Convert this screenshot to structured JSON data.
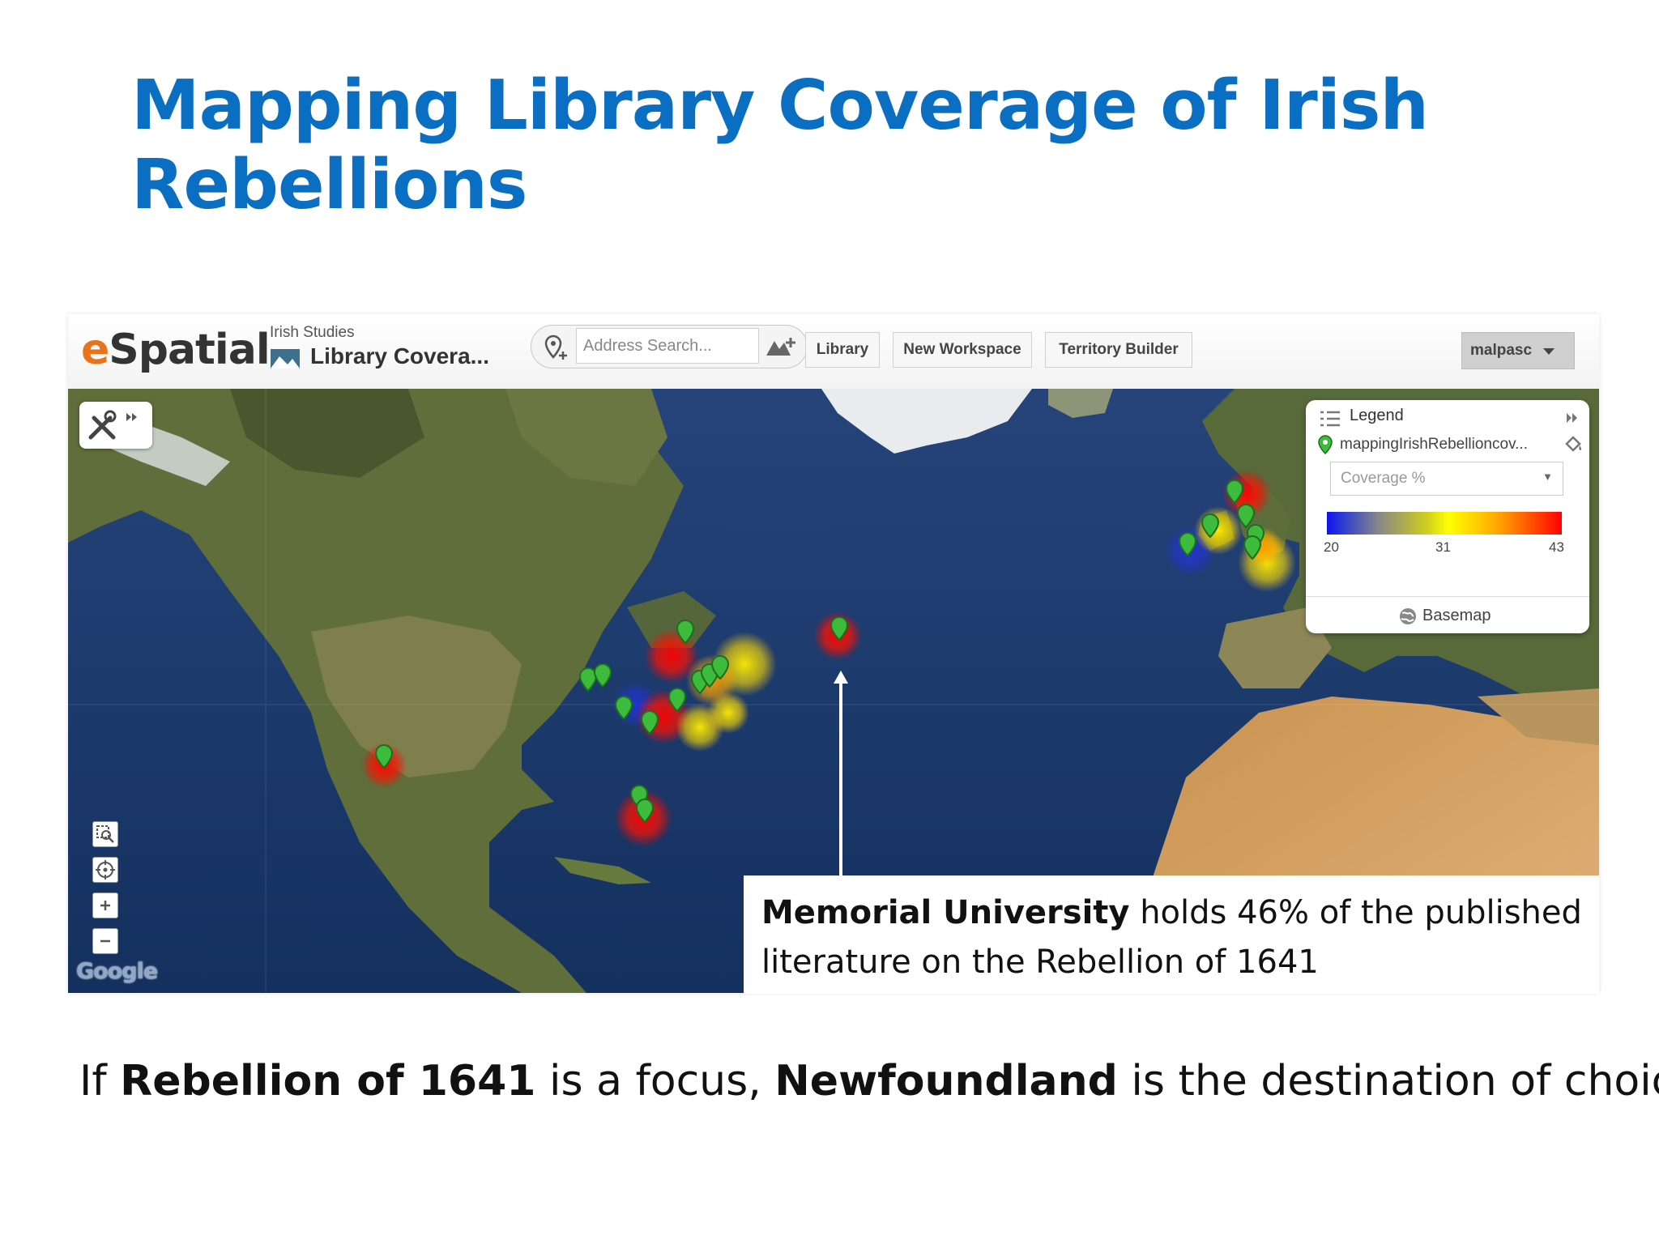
{
  "slide": {
    "title": "Mapping Library Coverage of Irish Rebellions",
    "caption": {
      "t1": "If ",
      "b1": "Rebellion of 1641",
      "t2": " is a focus, ",
      "b2": "Newfoundland",
      "t3": " is the destination of choice."
    }
  },
  "app": {
    "logo_e": "e",
    "logo_rest": "Spatial",
    "breadcrumb": {
      "section": "Irish Studies",
      "title": "Library Covera..."
    },
    "search": {
      "placeholder": "Address Search..."
    },
    "nav": [
      "Library",
      "New Workspace",
      "Territory Builder"
    ],
    "user": "malpasc",
    "icons": {
      "add_location": "add-location-icon",
      "add_map": "add-map-icon",
      "tools": "tools-icon",
      "zoom_box": "zoom-box-icon",
      "locate": "locate-icon",
      "zoom_in": "zoom-in-icon",
      "zoom_out": "zoom-out-icon",
      "legend": "legend-list-icon",
      "collapse": "double-chevron-icon",
      "layer_pin": "map-pin-icon",
      "paint": "paint-bucket-icon",
      "globe": "globe-icon"
    },
    "map_attribution": "Google",
    "legend": {
      "title": "Legend",
      "layer": "mappingIrishRebellioncov...",
      "field": "Coverage %",
      "scale": {
        "min": "20",
        "mid": "31",
        "max": "43"
      },
      "basemap": "Basemap"
    },
    "callout": {
      "bold": "Memorial University",
      "text": " holds 46% of the published literature on the Rebellion of 1641"
    },
    "colors": {
      "title_blue": "#0a6fc2",
      "logo_orange": "#e8731a",
      "pin_green": "#3dbb3d",
      "heat_red": "#ff0000",
      "heat_yellow": "#ffee00",
      "heat_blue": "#2233dd",
      "ocean": "#1a3f7a",
      "land": "#5f6e3a"
    }
  }
}
